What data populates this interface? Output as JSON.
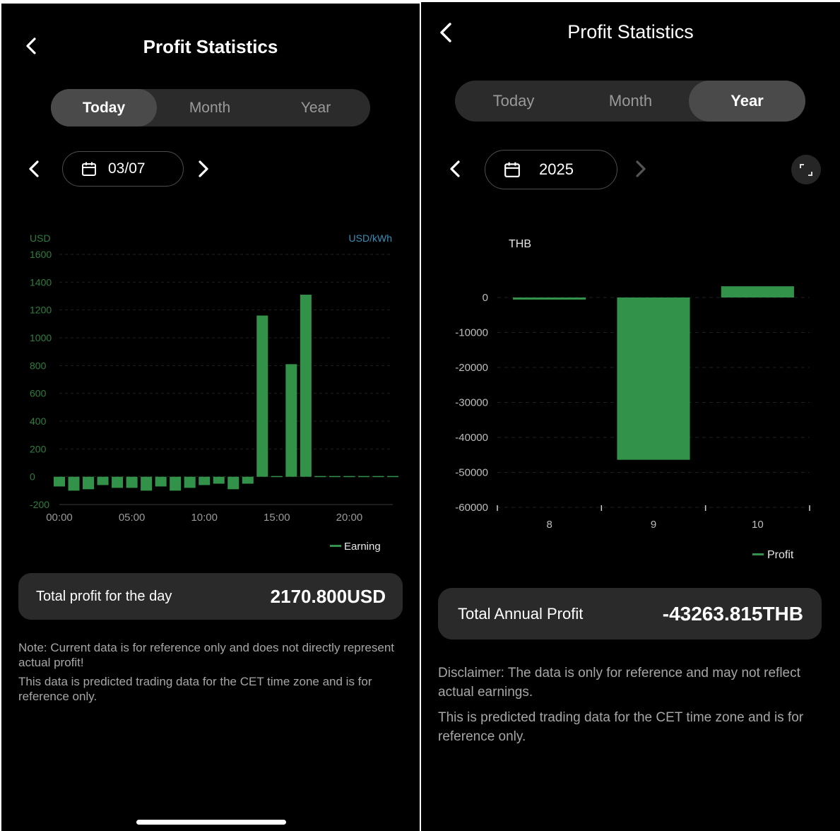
{
  "left": {
    "title": "Profit Statistics",
    "tabs": [
      {
        "label": "Today",
        "active": true
      },
      {
        "label": "Month",
        "active": false
      },
      {
        "label": "Year",
        "active": false
      }
    ],
    "date": "03/07",
    "icons": {
      "back": "chevron-left-icon",
      "prev": "chevron-left-icon",
      "next": "chevron-right-icon",
      "calendar": "calendar-icon"
    },
    "total": {
      "label": "Total profit for the day",
      "value": "2170.800USD"
    },
    "notes": [
      "Note: Current data is for reference only and does not directly represent actual profit!",
      "This data is predicted trading data for the CET time zone and is for reference only."
    ]
  },
  "right": {
    "title": "Profit Statistics",
    "tabs": [
      {
        "label": "Today",
        "active": false
      },
      {
        "label": "Month",
        "active": false
      },
      {
        "label": "Year",
        "active": true
      }
    ],
    "date": "2025",
    "icons": {
      "back": "chevron-left-icon",
      "prev": "chevron-left-icon",
      "next": "chevron-right-icon",
      "calendar": "calendar-icon",
      "expand": "expand-icon"
    },
    "total": {
      "label": "Total Annual Profit",
      "value": "-43263.815THB"
    },
    "notes": [
      "Disclaimer: The data is only for reference and may not reflect actual earnings.",
      "This is predicted trading data for the CET time zone and is for reference only."
    ]
  },
  "colors": {
    "bar": "#33924a",
    "left_axis": "#2f7d3f",
    "right_axis_label": "#3a8fb7",
    "background": "#000000",
    "card": "#2a2a2a"
  },
  "chart_data": [
    {
      "type": "bar",
      "y_unit_left": "USD",
      "y_unit_right": "USD/kWh",
      "ylim": [
        -200,
        1600
      ],
      "yticks": [
        -200,
        0,
        200,
        400,
        600,
        800,
        1000,
        1200,
        1400,
        1600
      ],
      "xtick_labels": [
        "00:00",
        "05:00",
        "10:00",
        "15:00",
        "20:00"
      ],
      "xtick_hours": [
        0,
        5,
        10,
        15,
        20
      ],
      "x": [
        0,
        1,
        2,
        3,
        4,
        5,
        6,
        7,
        8,
        9,
        10,
        11,
        12,
        13,
        14,
        15,
        16,
        17,
        18,
        19,
        20,
        21,
        22,
        23
      ],
      "series": [
        {
          "name": "Earning",
          "values": [
            -70,
            -100,
            -90,
            -60,
            -80,
            -80,
            -100,
            -70,
            -100,
            -80,
            -60,
            -50,
            -90,
            -50,
            1160,
            5,
            810,
            1310,
            5,
            5,
            5,
            5,
            5,
            5
          ]
        }
      ],
      "legend": "bottom-right",
      "grid": true
    },
    {
      "type": "bar",
      "y_unit": "THB",
      "ylim": [
        -60000,
        0
      ],
      "yticks": [
        0,
        -10000,
        -20000,
        -30000,
        -40000,
        -50000,
        -60000
      ],
      "categories": [
        "8",
        "9",
        "10"
      ],
      "series": [
        {
          "name": "Profit",
          "values": [
            -600,
            -46400,
            3200
          ]
        }
      ],
      "legend": "bottom-right",
      "grid": true
    }
  ]
}
